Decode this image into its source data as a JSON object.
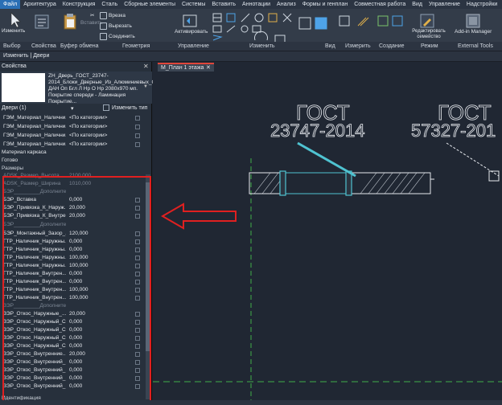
{
  "menubar": {
    "items": [
      "Файл",
      "Архитектура",
      "Конструкция",
      "Сталь",
      "Сборные элементы",
      "Системы",
      "Вставить",
      "Аннотации",
      "Анализ",
      "Формы и генплан",
      "Совместная работа",
      "Вид",
      "Управление",
      "Надстройки"
    ]
  },
  "ribbon": {
    "modify_label": "Изменить",
    "vrezka_label": "Врезка",
    "vyrezat_label": "Вырезать",
    "soedinit_label": "Соединить",
    "activate_label": "Активировать",
    "edit_family_label": "Редактировать семейство",
    "addin_label": "Add-in Manager",
    "groups": [
      "Выбор",
      "Свойства",
      "Буфер обмена",
      "Геометрия",
      "Управление",
      "Изменить",
      "Вид",
      "Измерить",
      "Создание",
      "Режим",
      "External Tools"
    ]
  },
  "optionsbar": {
    "text": "Изменить | Двери"
  },
  "properties": {
    "title": "Свойства",
    "type_name": "ZH_Дверь_ГОСТ_23747-2014_Блоки_Дверные_Из_Алюминиевых_Сплавов_Новое ДАН Оп Бгл Л Нр О Нр 2080х970 мп. Покрытие спереди - Ламинация Покрытие...",
    "filter_label": "Двери (1)",
    "edit_type_label": "Изменить тип",
    "rows": [
      {
        "name": "ГЭМ_Материал_Налични...",
        "value": "<По категории>"
      },
      {
        "name": "ГЭМ_Материал_Налични...",
        "value": "<По категории>"
      },
      {
        "name": "ГЭМ_Материал_Налични...",
        "value": "<По категории>"
      },
      {
        "name": "ГЭМ_Материал_Налични...",
        "value": "<По категории>"
      },
      {
        "name": "Материал каркаса",
        "value": ""
      },
      {
        "name": "Готово",
        "value": ""
      }
    ],
    "section_sizes": "Размеры",
    "size_rows": [
      {
        "name": "ADSK_Размер_Высота",
        "value": "2100,000",
        "dim": true
      },
      {
        "name": "ADSK_Размер_Ширина",
        "value": "1010,000",
        "dim": true
      },
      {
        "name": "БЭР_________Дополните...",
        "value": "",
        "dim": true
      },
      {
        "name": "БЭР_Вставка",
        "value": "0,000"
      },
      {
        "name": "БЭР_Привязка_К_Наруж...",
        "value": "20,000"
      },
      {
        "name": "БЭР_Привязка_К_Внутре...",
        "value": "20,000"
      },
      {
        "name": "БЭР_________Дополните...",
        "value": "",
        "dim": true
      },
      {
        "name": "БЭР_Монтажный_Зазор_...",
        "value": "120,000"
      },
      {
        "name": "ГТР_Наличник_Наружны...",
        "value": "0,000"
      },
      {
        "name": "ГТР_Наличник_Наружны...",
        "value": "0,000"
      },
      {
        "name": "ГТР_Наличник_Наружны...",
        "value": "100,000"
      },
      {
        "name": "ГТР_Наличник_Наружны...",
        "value": "100,000"
      },
      {
        "name": "ГТР_Наличник_Внутрен...",
        "value": "0,000"
      },
      {
        "name": "ГТР_Наличник_Внутрен...",
        "value": "0,000"
      },
      {
        "name": "ГТР_Наличник_Внутрен...",
        "value": "100,000"
      },
      {
        "name": "ГТР_Наличник_Внутрен...",
        "value": "100,000"
      },
      {
        "name": "ЗЭР_________Дополните...",
        "value": "",
        "dim": true
      },
      {
        "name": "ЗЭР_Откос_Наружные_...",
        "value": "20,000"
      },
      {
        "name": "ЗЭР_Откос_Наружный_С...",
        "value": "0,000"
      },
      {
        "name": "ЗЭР_Откос_Наружный_С...",
        "value": "0,000"
      },
      {
        "name": "ЗЭР_Откос_Наружный_С...",
        "value": "0,000"
      },
      {
        "name": "ЗЭР_Откос_Наружный_С...",
        "value": "0,000"
      },
      {
        "name": "ЗЭР_Откос_Внутренние...",
        "value": "20,000"
      },
      {
        "name": "ЗЭР_Откос_Внутренний_...",
        "value": "0,000"
      },
      {
        "name": "ЗЭР_Откос_Внутренний_...",
        "value": "0,000"
      },
      {
        "name": "ЗЭР_Откос_Внутренний_...",
        "value": "0,000"
      },
      {
        "name": "ЗЭР_Откос_Внутренний_...",
        "value": "0,000"
      }
    ],
    "bottom_section": "Идентификация"
  },
  "canvas": {
    "tab_label": "М_План 1 этажа",
    "gost1_title": "ГОСТ",
    "gost1_num": "23747-2014",
    "gost2_title": "ГОСТ",
    "gost2_num": "57327-201"
  },
  "colors": {
    "accent": "#2a6fb5",
    "door_cyan": "#4fc3d1",
    "highlight_red": "#e02020",
    "guide_green": "#3fae4a"
  }
}
